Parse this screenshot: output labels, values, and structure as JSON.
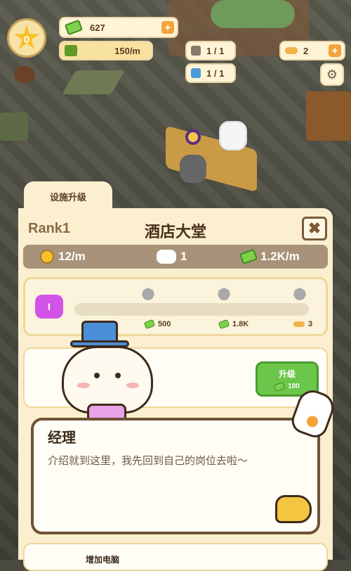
{
  "hud": {
    "level": "0",
    "cash": "627",
    "income": "150/m",
    "tools": "1 / 1",
    "potion": "1 / 1",
    "fish": "2"
  },
  "panel": {
    "tab_label": "设施升级",
    "rank": "Rank1",
    "title": "酒店大堂",
    "stats": {
      "time_rate": "12/m",
      "cats": "1",
      "income_rate": "1.2K/m"
    },
    "progress": {
      "level_badge": "I",
      "costs": [
        "500",
        "1.8K",
        "3"
      ]
    },
    "upgrade_button": {
      "label": "升级",
      "cost": "100"
    },
    "bottom_item": "增加电脑"
  },
  "dialog": {
    "speaker": "经理",
    "text": "介绍就到这里，我先回到自己的岗位去啦～"
  },
  "colors": {
    "panel_bg": "#fbefcf",
    "accent_green": "#6bc64a",
    "accent_orange": "#f4a23b",
    "badge_purple": "#d253e8"
  }
}
